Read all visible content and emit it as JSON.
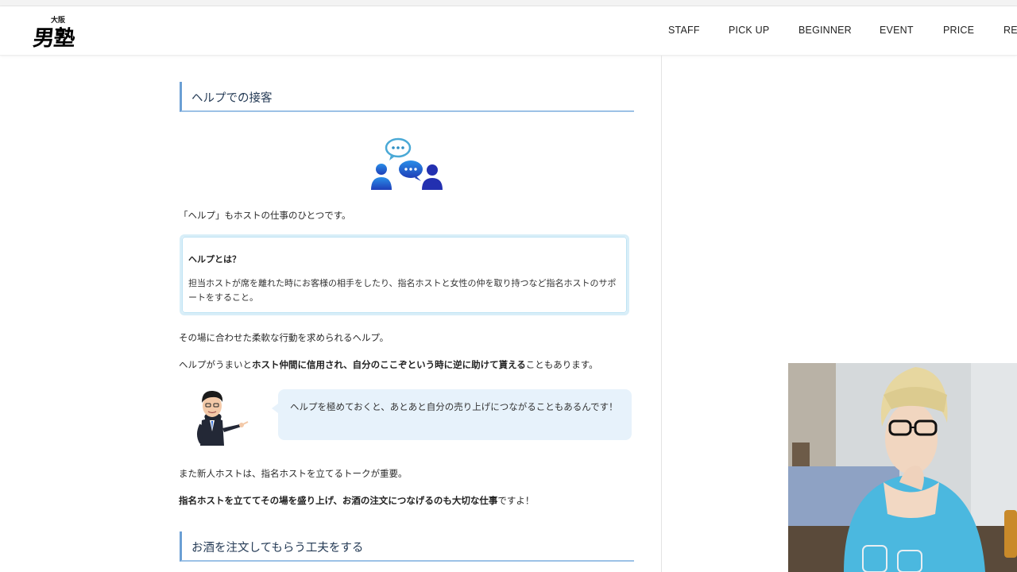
{
  "header": {
    "logo_small": "大阪",
    "logo_main": "男塾",
    "nav": [
      "STAFF",
      "PICK UP",
      "BEGINNER",
      "EVENT",
      "PRICE",
      "REC"
    ]
  },
  "article": {
    "heading1": "ヘルプでの接客",
    "intro": "「ヘルプ」もホストの仕事のひとつです。",
    "box": {
      "title": "ヘルプとは？",
      "text": "担当ホストが席を離れた時にお客様の相手をしたり、指名ホストと女性の仲を取り持つなど指名ホストのサポートをすること。"
    },
    "para1": "その場に合わせた柔軟な行動を求められるヘルプ。",
    "para2": {
      "pre": "ヘルプがうまいと",
      "bold": "ホスト仲間に信用され、自分のここぞという時に逆に助けて貰える",
      "post": "こともあります。"
    },
    "bubble": "ヘルプを極めておくと、あとあと自分の売り上げにつながることもあるんです！",
    "para3": "また新人ホストは、指名ホストを立てるトークが重要。",
    "para4": {
      "bold": "指名ホストを立ててその場を盛り上げ、お酒の注文につなげるのも大切な仕事",
      "post": "ですよ！"
    },
    "heading2": "お酒を注文してもらう工夫をする"
  },
  "colors": {
    "heading_border": "#6b9fd4",
    "bubble_bg": "#e7f2fb",
    "icon_blue": "#1a6fd0"
  }
}
